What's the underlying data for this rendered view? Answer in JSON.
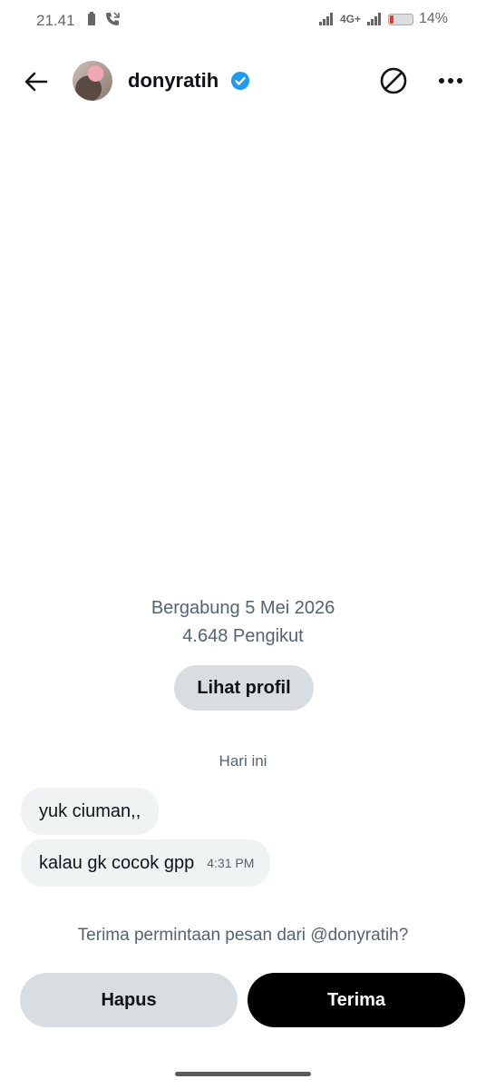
{
  "status_bar": {
    "time": "21.41",
    "network": "4G+",
    "battery_percent": "14%",
    "battery_level": 0.14,
    "icons": [
      "battery-saver-icon",
      "call-icon",
      "signal-icon",
      "signal-icon",
      "battery-icon"
    ]
  },
  "header": {
    "username": "donyratih",
    "icons": [
      "back-arrow-icon",
      "verified-badge-icon",
      "block-icon",
      "more-options-icon"
    ],
    "accent_color": "#1d9bf0"
  },
  "profile_info": {
    "joined": "Bergabung 5 Mei 2026",
    "followers": "4.648 Pengikut",
    "view_profile_label": "Lihat profil"
  },
  "conversation": {
    "day_label": "Hari ini",
    "messages": [
      {
        "text": "yuk ciuman,,",
        "time": ""
      },
      {
        "text": "kalau gk cocok gpp",
        "time": "4:31 PM"
      }
    ]
  },
  "request": {
    "prompt": "Terima permintaan pesan dari @donyratih?",
    "delete_label": "Hapus",
    "accept_label": "Terima"
  }
}
